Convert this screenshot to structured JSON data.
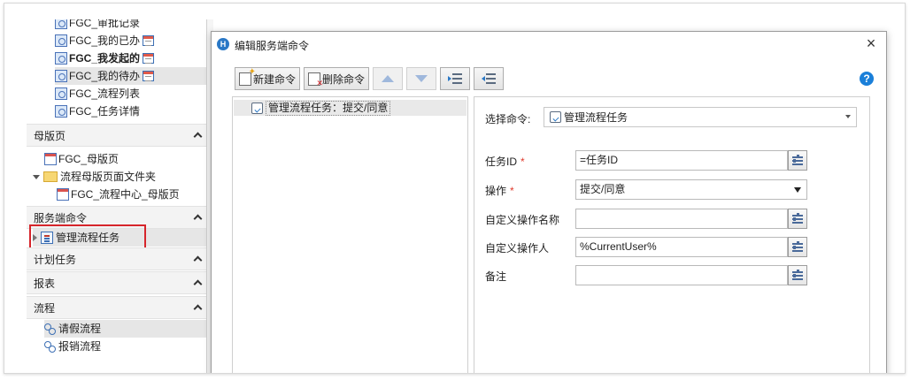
{
  "left_panel": {
    "pages": [
      {
        "label": "FGC_审批记录",
        "bold": false,
        "grid": false
      },
      {
        "label": "FGC_我的已办",
        "bold": false,
        "grid": true
      },
      {
        "label": "FGC_我发起的",
        "bold": true,
        "grid": true
      },
      {
        "label": "FGC_我的待办",
        "bold": false,
        "grid": true
      },
      {
        "label": "FGC_流程列表",
        "bold": false,
        "grid": false
      },
      {
        "label": "FGC_任务详情",
        "bold": false,
        "grid": false
      }
    ],
    "sections": {
      "master": "母版页",
      "server_cmd": "服务端命令",
      "scheduled": "计划任务",
      "reports": "报表",
      "flows": "流程"
    },
    "master_pages": {
      "master": "FGC_母版页",
      "folder": "流程母版页面文件夹",
      "flow_center": "FGC_流程中心_母版页"
    },
    "server_cmd_item": "管理流程任务",
    "flow_items": [
      "请假流程",
      "报销流程"
    ]
  },
  "dialog": {
    "title": "编辑服务端命令",
    "close": "×",
    "app_icon": "H",
    "toolbar": {
      "new_cmd": "新建命令",
      "delete_cmd": "删除命令"
    },
    "help": "?",
    "tree_item": "管理流程任务：提交/同意",
    "props": {
      "select_cmd_label": "选择命令:",
      "select_cmd_value": "管理流程任务",
      "task_id_label": "任务ID",
      "task_id_value": "=任务ID",
      "operation_label": "操作",
      "operation_value": "提交/同意",
      "custom_op_name_label": "自定义操作名称",
      "custom_op_name_value": "",
      "custom_operator_label": "自定义操作人",
      "custom_operator_value": "%CurrentUser%",
      "remark_label": "备注",
      "remark_value": "",
      "required_mark": "*"
    }
  },
  "colors": {
    "highlight_box": "#d6252b",
    "accent_blue": "#2a78c6",
    "required": "#e0392b"
  }
}
